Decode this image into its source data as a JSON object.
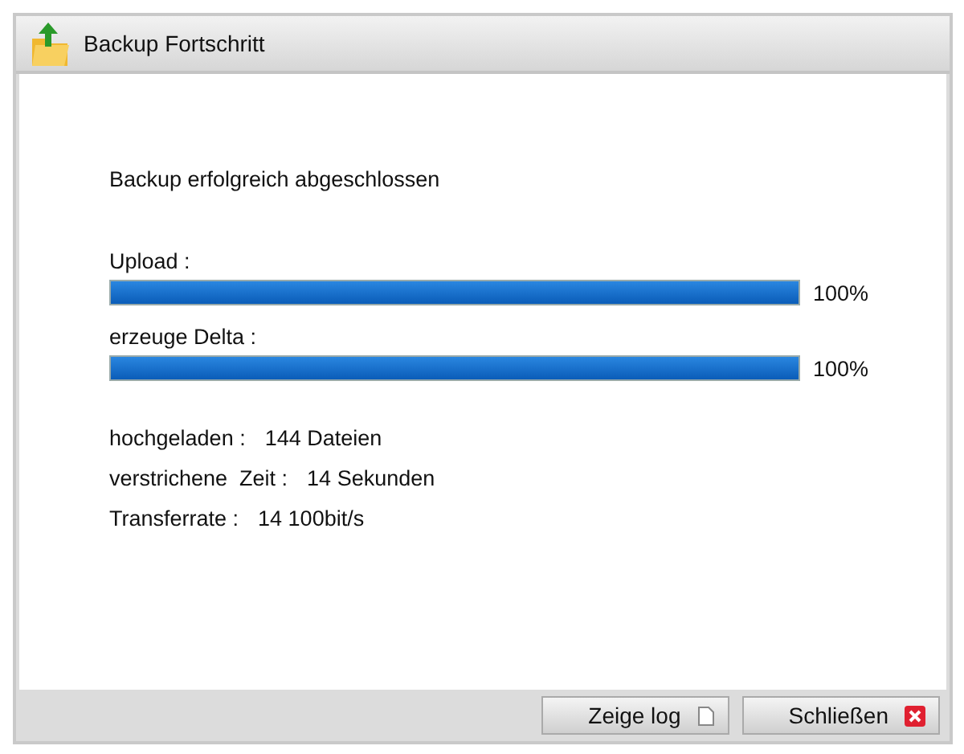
{
  "window": {
    "title": "Backup Fortschritt"
  },
  "message": "Backup erfolgreich abgeschlossen",
  "progress": [
    {
      "label": "Upload :",
      "level": 1,
      "reading": "100%"
    },
    {
      "label": "erzeuge Delta :",
      "level": 1,
      "reading": "100%"
    }
  ],
  "stats": [
    {
      "label": "hochgeladen :",
      "value": "144 Dateien"
    },
    {
      "label": "verstrichene  Zeit :",
      "value": "14 Sekunden"
    },
    {
      "label": "Transferrate :",
      "value": "14 100bit/s"
    }
  ],
  "buttons": [
    {
      "label": "Zeige log",
      "kind": "log"
    },
    {
      "label": "Schließen",
      "kind": "close"
    }
  ]
}
